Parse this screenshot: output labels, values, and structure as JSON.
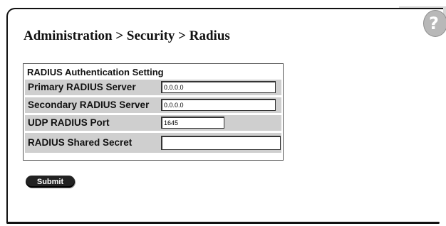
{
  "breadcrumb": "Administration > Security > Radius",
  "help": {
    "icon": "help-icon",
    "glyph": "?"
  },
  "panel": {
    "title": "RADIUS Authentication Setting",
    "fields": [
      {
        "label": "Primary RADIUS Server",
        "value": "0.0.0.0"
      },
      {
        "label": "Secondary RADIUS Server",
        "value": "0.0.0.0"
      },
      {
        "label": "UDP RADIUS Port",
        "value": "1645"
      },
      {
        "label": "RADIUS Shared Secret",
        "value": ""
      }
    ]
  },
  "submit_label": "Submit"
}
